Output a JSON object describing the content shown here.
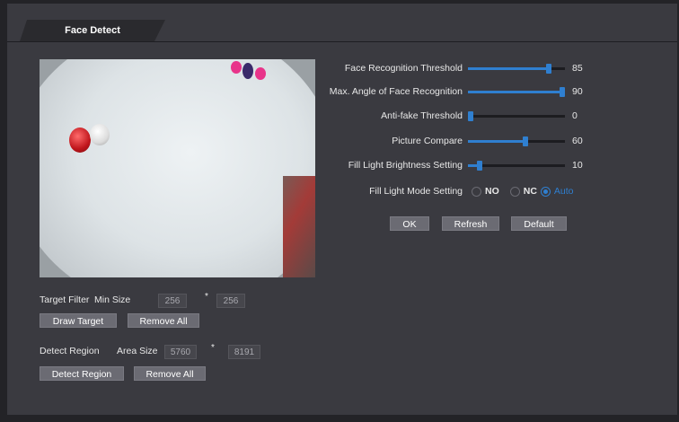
{
  "tab": {
    "title": "Face Detect"
  },
  "colors": {
    "accent": "#2f7fd0",
    "panel": "#3a3a40",
    "button": "#6b6b73"
  },
  "settings": {
    "sliders": [
      {
        "label": "Face Recognition Threshold",
        "value": "85",
        "fraction": 0.85
      },
      {
        "label": "Max. Angle of Face Recognition",
        "value": "90",
        "fraction": 1.0
      },
      {
        "label": "Anti-fake Threshold",
        "value": "0",
        "fraction": 0.0
      },
      {
        "label": "Picture Compare",
        "value": "60",
        "fraction": 0.6
      },
      {
        "label": "Fill Light Brightness Setting",
        "value": "10",
        "fraction": 0.1
      }
    ],
    "fill_light_mode": {
      "label": "Fill Light Mode Setting",
      "options": [
        "NO",
        "NC",
        "Auto"
      ],
      "selected": "Auto"
    },
    "buttons": {
      "ok": "OK",
      "refresh": "Refresh",
      "default": "Default"
    }
  },
  "target_filter": {
    "label": "Target Filter",
    "min_size_label": "Min Size",
    "width": "256",
    "height": "256",
    "separator": "*",
    "draw_button": "Draw Target",
    "remove_button": "Remove All"
  },
  "detect_region": {
    "label": "Detect Region",
    "area_size_label": "Area Size",
    "width": "5760",
    "height": "8191",
    "separator": "*",
    "detect_button": "Detect Region",
    "remove_button": "Remove All"
  }
}
